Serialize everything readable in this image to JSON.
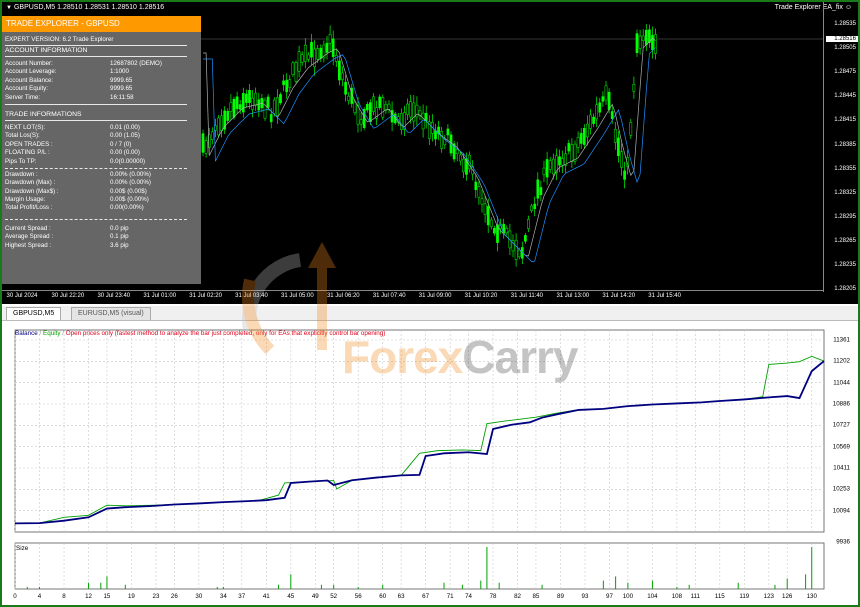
{
  "chart": {
    "title": "GBPUSD,M5  1.28510 1.28531 1.28510 1.28516",
    "ea_label": "Trade Explorer EA_fix",
    "current_price": "1.28516",
    "price_ticks": [
      "1.28535",
      "1.28505",
      "1.28475",
      "1.28445",
      "1.28415",
      "1.28385",
      "1.28355",
      "1.28325",
      "1.28295",
      "1.28265",
      "1.28235",
      "1.28205"
    ],
    "time_ticks": [
      "30 Jul 2024",
      "30 Jul 22:20",
      "30 Jul 23:40",
      "31 Jul 01:00",
      "31 Jul 02:20",
      "31 Jul 03:40",
      "31 Jul 05:00",
      "31 Jul 06:20",
      "31 Jul 07:40",
      "31 Jul 09:00",
      "31 Jul 10:20",
      "31 Jul 11:40",
      "31 Jul 13:00",
      "31 Jul 14:20",
      "31 Jul 15:40"
    ],
    "colors": {
      "bull": "#00ff00",
      "ma1": "#b0b0b0",
      "ma2": "#1e90ff"
    }
  },
  "panel": {
    "title": "TRADE EXPLORER - GBPUSD",
    "version": "EXPERT VERSION: 6.2 Trade Explorer",
    "account_header": "ACCOUNT INFORMATION",
    "account_rows": [
      {
        "label": "Account Number:",
        "value": "12687802 (DEMO)"
      },
      {
        "label": "Account Leverage:",
        "value": "1:1000"
      },
      {
        "label": "Account Balance:",
        "value": "9999.65"
      },
      {
        "label": "Account Equity:",
        "value": "9999.65"
      },
      {
        "label": "Server Time:",
        "value": "16:11:58"
      }
    ],
    "trade_header": "TRADE INFORMATIONS",
    "trade_rows": [
      {
        "label": "NEXT LOT(S):",
        "value": "0.01 (0.00)"
      },
      {
        "label": "Total Los(S):",
        "value": "0.00 (1.05)"
      },
      {
        "label": "OPEN TRADES :",
        "value": "0 / 7 (0)"
      },
      {
        "label": "FLOATING P/L :",
        "value": "0.00 (0.00)"
      },
      {
        "label": "Pips To TP:",
        "value": "0.0(0.00000)"
      }
    ],
    "dd_rows": [
      {
        "label": "Drawdown :",
        "value": "0.00% (0.00%)"
      },
      {
        "label": "Drawdown (Max) :",
        "value": "0.00% (0.00%)"
      },
      {
        "label": "Drawdown (Max$) :",
        "value": "0.00$ (0.00$)"
      },
      {
        "label": "Margin Usage:",
        "value": "0.00$ (0.00%)"
      },
      {
        "label": "Total Profit/Loss :",
        "value": "0.00(0.00%)"
      }
    ],
    "spread_rows": [
      {
        "label": "Current Spread :",
        "value": "0.0 pip"
      },
      {
        "label": "Average Spread :",
        "value": "0.1 pip"
      },
      {
        "label": "Highest Spread :",
        "value": "3.6 pip"
      }
    ]
  },
  "tabs": [
    "GBPUSD,M5",
    "EURUSD,M5 (visual)"
  ],
  "report": {
    "legend": {
      "balance": "Balance",
      "sep": " / ",
      "equity": "Equity",
      "sep2": " / ",
      "note": "Open prices only (fastest method to analyze the bar just completed, only for EAs that explicitly control bar opening)"
    },
    "size_label": "Size",
    "colors": {
      "balance": "#00007f",
      "equity": "#00a000",
      "size": "#00a000"
    },
    "chart_data": {
      "type": "line",
      "ylim": [
        9936,
        11361
      ],
      "y_ticks": [
        "11361",
        "11202",
        "11044",
        "10886",
        "10727",
        "10569",
        "10411",
        "10253",
        "10094",
        "9936"
      ],
      "x_ticks": [
        "0",
        "4",
        "8",
        "12",
        "15",
        "19",
        "23",
        "26",
        "30",
        "34",
        "37",
        "41",
        "45",
        "49",
        "52",
        "56",
        "60",
        "63",
        "67",
        "71",
        "74",
        "78",
        "82",
        "85",
        "89",
        "93",
        "97",
        "100",
        "104",
        "108",
        "111",
        "115",
        "119",
        "123",
        "126",
        "130"
      ],
      "xlim": [
        0,
        132
      ],
      "series": [
        {
          "name": "Balance",
          "points": [
            [
              0,
              10000
            ],
            [
              4,
              10002
            ],
            [
              8,
              10020
            ],
            [
              12,
              10045
            ],
            [
              15,
              10110
            ],
            [
              18,
              10120
            ],
            [
              22,
              10128
            ],
            [
              26,
              10140
            ],
            [
              30,
              10148
            ],
            [
              34,
              10158
            ],
            [
              38,
              10165
            ],
            [
              41,
              10172
            ],
            [
              44,
              10190
            ],
            [
              45,
              10300
            ],
            [
              48,
              10310
            ],
            [
              51,
              10318
            ],
            [
              52,
              10285
            ],
            [
              55,
              10320
            ],
            [
              59,
              10340
            ],
            [
              63,
              10356
            ],
            [
              66,
              10360
            ],
            [
              67,
              10500
            ],
            [
              70,
              10520
            ],
            [
              74,
              10528
            ],
            [
              77,
              10515
            ],
            [
              78,
              10700
            ],
            [
              81,
              10732
            ],
            [
              84,
              10750
            ],
            [
              86,
              10785
            ],
            [
              89,
              10815
            ],
            [
              92,
              10842
            ],
            [
              96,
              10850
            ],
            [
              100,
              10870
            ],
            [
              104,
              10882
            ],
            [
              108,
              10890
            ],
            [
              112,
              10898
            ],
            [
              115,
              10908
            ],
            [
              119,
              10920
            ],
            [
              123,
              10935
            ],
            [
              126,
              10945
            ],
            [
              128,
              10930
            ],
            [
              130,
              11130
            ],
            [
              132,
              11205
            ]
          ]
        },
        {
          "name": "Equity",
          "points": [
            [
              0,
              10000
            ],
            [
              4,
              10002
            ],
            [
              8,
              10045
            ],
            [
              12,
              10060
            ],
            [
              15,
              10135
            ],
            [
              18,
              10130
            ],
            [
              22,
              10134
            ],
            [
              26,
              10140
            ],
            [
              30,
              10148
            ],
            [
              34,
              10158
            ],
            [
              38,
              10165
            ],
            [
              40,
              10172
            ],
            [
              43,
              10210
            ],
            [
              44,
              10300
            ],
            [
              48,
              10310
            ],
            [
              52,
              10318
            ],
            [
              52.5,
              10255
            ],
            [
              55,
              10320
            ],
            [
              59,
              10340
            ],
            [
              63,
              10356
            ],
            [
              66,
              10520
            ],
            [
              69,
              10540
            ],
            [
              73,
              10545
            ],
            [
              76,
              10540
            ],
            [
              77,
              10740
            ],
            [
              80,
              10760
            ],
            [
              85,
              10788
            ],
            [
              88,
              10815
            ],
            [
              92,
              10845
            ],
            [
              96,
              10850
            ],
            [
              100,
              10870
            ],
            [
              104,
              10882
            ],
            [
              108,
              10890
            ],
            [
              112,
              10898
            ],
            [
              115,
              10908
            ],
            [
              119,
              10920
            ],
            [
              122,
              10940
            ],
            [
              123,
              11180
            ],
            [
              126,
              11190
            ],
            [
              128,
              11200
            ],
            [
              130,
              11240
            ],
            [
              132,
              11205
            ]
          ]
        }
      ],
      "size_bars": [
        [
          2,
          0.05
        ],
        [
          4,
          0.05
        ],
        [
          12,
          0.15
        ],
        [
          14,
          0.15
        ],
        [
          15,
          0.3
        ],
        [
          18,
          0.1
        ],
        [
          33,
          0.05
        ],
        [
          34,
          0.05
        ],
        [
          43,
          0.1
        ],
        [
          45,
          0.35
        ],
        [
          50,
          0.1
        ],
        [
          52,
          0.1
        ],
        [
          56,
          0.05
        ],
        [
          60,
          0.1
        ],
        [
          70,
          0.15
        ],
        [
          73,
          0.1
        ],
        [
          76,
          0.2
        ],
        [
          77,
          1.0
        ],
        [
          79,
          0.15
        ],
        [
          86,
          0.1
        ],
        [
          96,
          0.2
        ],
        [
          98,
          0.3
        ],
        [
          100,
          0.15
        ],
        [
          104,
          0.2
        ],
        [
          108,
          0.05
        ],
        [
          110,
          0.1
        ],
        [
          118,
          0.15
        ],
        [
          124,
          0.1
        ],
        [
          126,
          0.25
        ],
        [
          129,
          0.35
        ],
        [
          130,
          1.0
        ]
      ]
    }
  }
}
